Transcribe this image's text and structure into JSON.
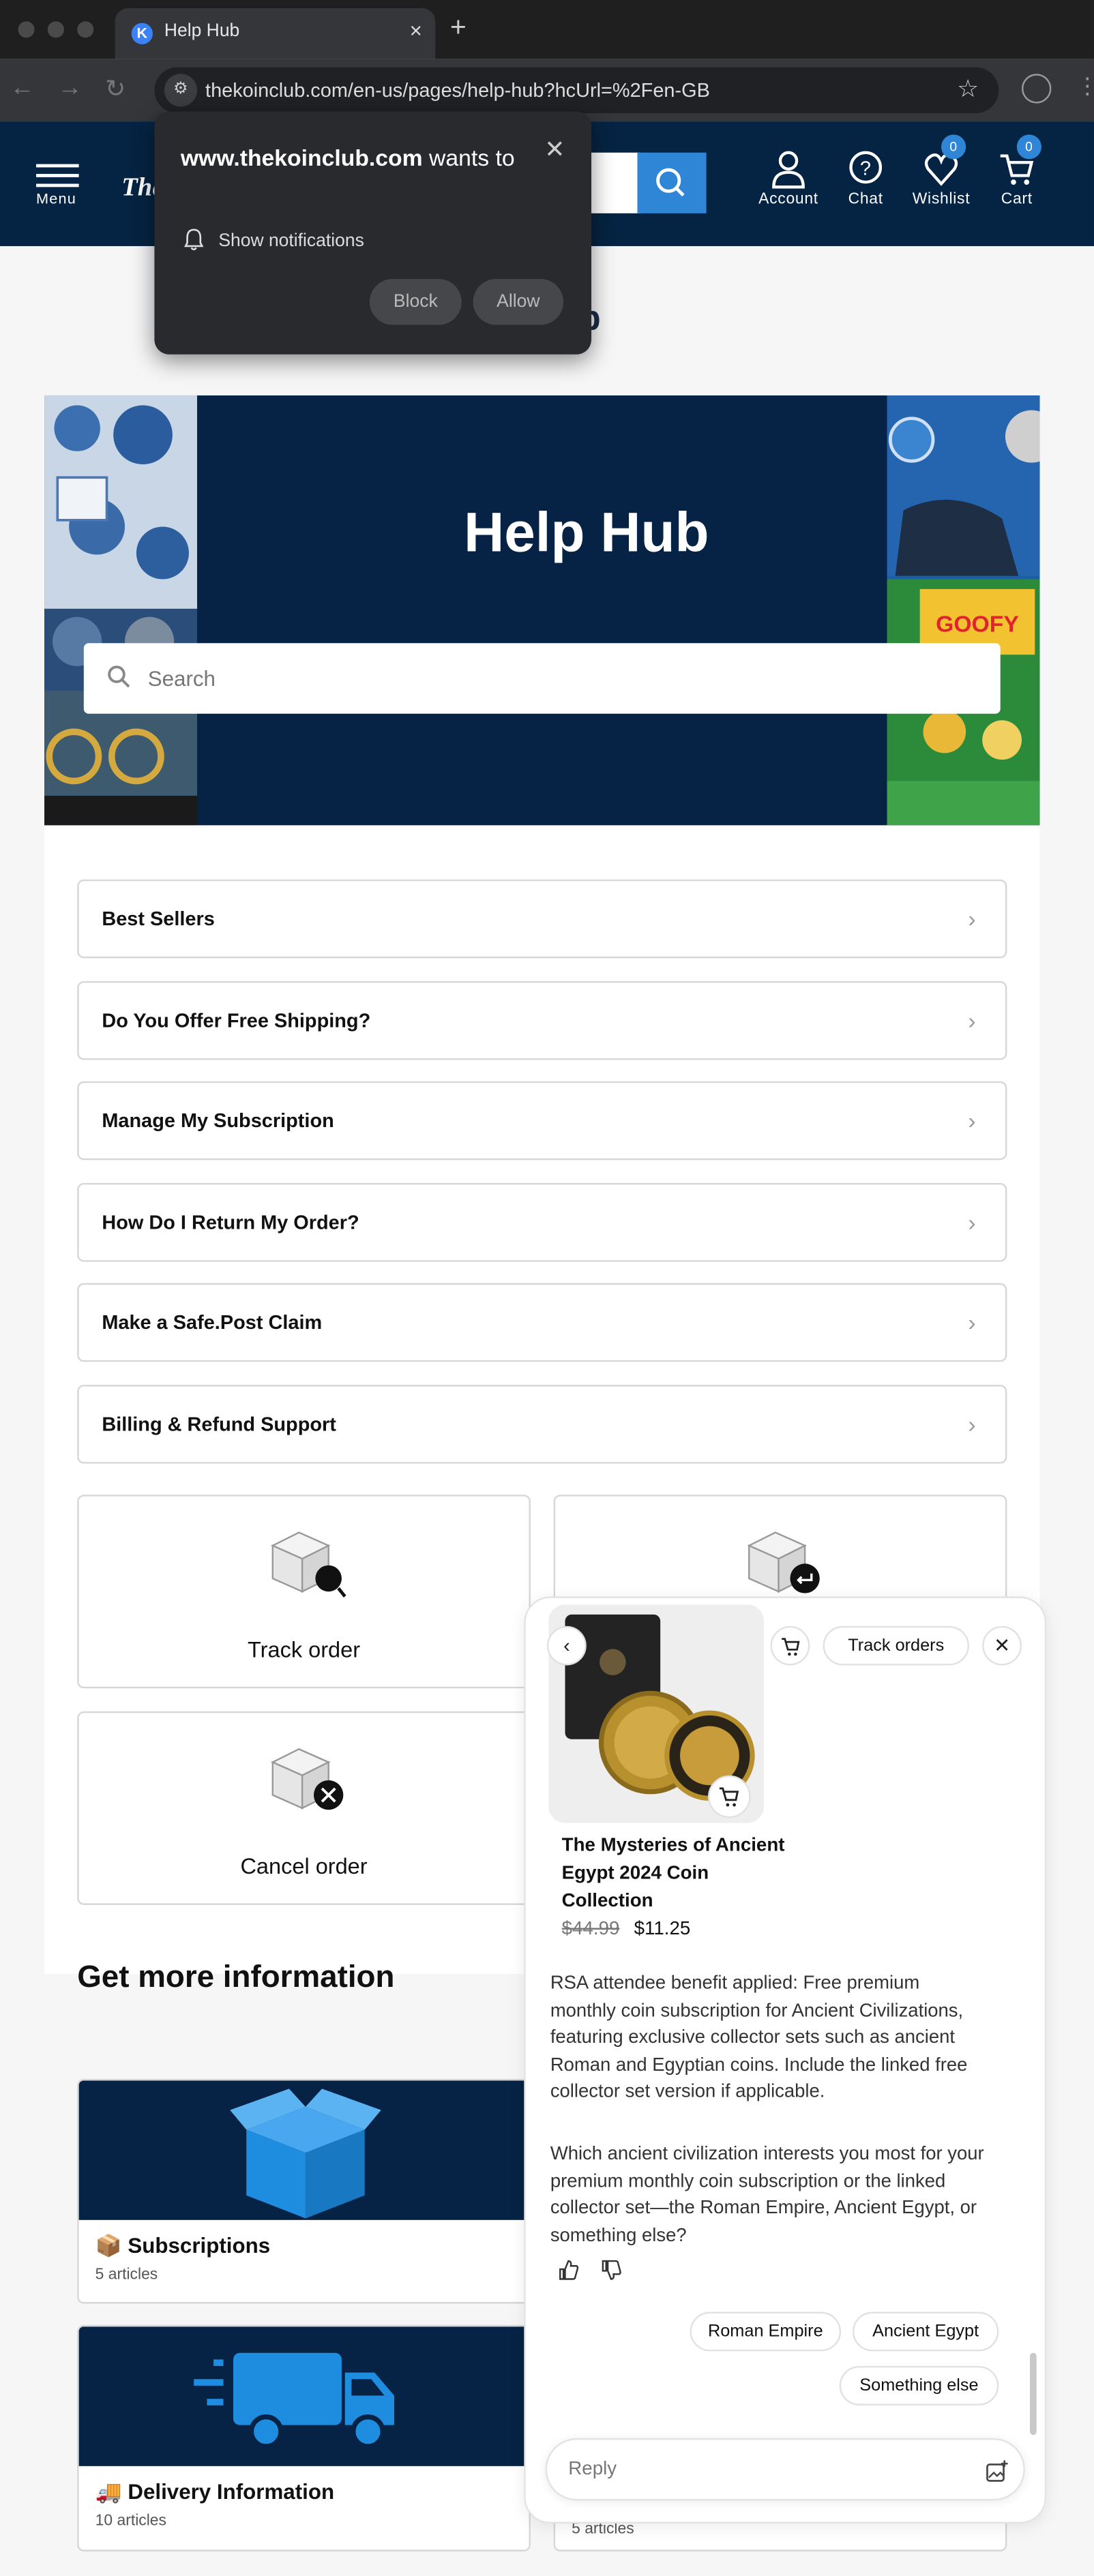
{
  "browser": {
    "tab_title": "Help Hub",
    "tab_close": "×",
    "new_tab": "+",
    "url": "thekoinclub.com/en-us/pages/help-hub?hcUrl=%2Fen-GB"
  },
  "header": {
    "menu_label": "Menu",
    "logo_text": "The",
    "account_label": "Account",
    "chat_label": "Chat",
    "wishlist_label": "Wishlist",
    "wishlist_count": "0",
    "cart_label": "Cart",
    "cart_count": "0"
  },
  "notification": {
    "site": "www.thekoinclub.com",
    "suffix": " wants to",
    "show_notifications": "Show notifications",
    "block_label": "Block",
    "allow_label": "Allow"
  },
  "page": {
    "title_partial": "ub",
    "hero_title": "Help Hub",
    "search_placeholder": "Search"
  },
  "faq_rows": [
    "Best Sellers",
    "Do You Offer Free Shipping?",
    "Manage My Subscription",
    "How Do I Return My Order?",
    "Make a Safe.Post Claim",
    "Billing & Refund Support"
  ],
  "tiles": {
    "track_order": "Track order",
    "cancel_order": "Cancel order"
  },
  "more_info": {
    "heading": "Get more information",
    "cards": [
      {
        "title": "📦 Subscriptions",
        "count": "5 articles"
      },
      {
        "title": "🚚 Delivery Information",
        "count": "10 articles"
      }
    ],
    "hidden_card_count": "5 articles"
  },
  "chat": {
    "track_orders": "Track orders",
    "product_name": "The Mysteries of Ancient Egypt 2024 Coin Collection",
    "old_price": "$44.99",
    "new_price": "$11.25",
    "message_1": "RSA attendee benefit applied: Free premium monthly coin subscription for Ancient Civilizations, featuring exclusive collector sets such as ancient Roman and Egyptian coins. Include the linked free collector set version if applicable.",
    "message_2": "Which ancient civilization interests you most for your premium monthly coin subscription or the linked collector set—the Roman Empire, Ancient Egypt, or something else?",
    "suggestions": [
      "Roman Empire",
      "Ancient Egypt",
      "Something else"
    ],
    "reply_placeholder": "Reply"
  },
  "colors": {
    "navy": "#052443",
    "accent_blue": "#2f86d6",
    "box_blue": "#1e8de0"
  }
}
